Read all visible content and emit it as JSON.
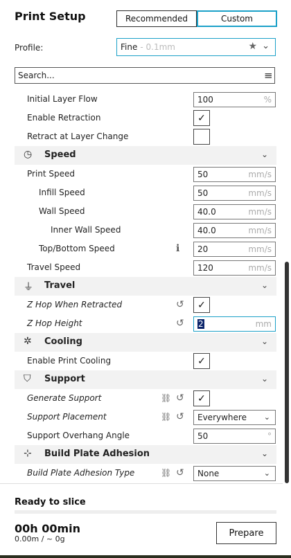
{
  "header": {
    "title": "Print Setup",
    "tabs": [
      "Recommended",
      "Custom"
    ],
    "profile_label": "Profile:",
    "profile_value": "Fine",
    "profile_sub": "- 0.1mm",
    "search_placeholder": "Search...",
    "star_icon": "★",
    "chevron": "⌄",
    "menu_icon": "≡"
  },
  "settings": {
    "initial_layer_flow": {
      "label": "Initial Layer Flow",
      "value": "100",
      "unit": "%"
    },
    "enable_retraction": {
      "label": "Enable Retraction",
      "checked": "✓"
    },
    "retract_layer_change": {
      "label": "Retract at Layer Change",
      "checked": ""
    },
    "speed_cat": {
      "label": "Speed",
      "icon": "◷"
    },
    "print_speed": {
      "label": "Print Speed",
      "value": "50",
      "unit": "mm/s"
    },
    "infill_speed": {
      "label": "Infill Speed",
      "value": "50",
      "unit": "mm/s"
    },
    "wall_speed": {
      "label": "Wall Speed",
      "value": "40.0",
      "unit": "mm/s"
    },
    "inner_wall_speed": {
      "label": "Inner Wall Speed",
      "value": "40.0",
      "unit": "mm/s"
    },
    "top_bottom_speed": {
      "label": "Top/Bottom Speed",
      "value": "20",
      "unit": "mm/s",
      "info_icon": "ℹ"
    },
    "travel_speed": {
      "label": "Travel Speed",
      "value": "120",
      "unit": "mm/s"
    },
    "travel_cat": {
      "label": "Travel",
      "icon": "⏚"
    },
    "z_hop_retracted": {
      "label": "Z Hop When Retracted",
      "checked": "✓",
      "reset_icon": "↺"
    },
    "z_hop_height": {
      "label": "Z Hop Height",
      "value": "2",
      "unit": "mm",
      "reset_icon": "↺"
    },
    "cooling_cat": {
      "label": "Cooling",
      "icon": "✲"
    },
    "enable_cooling": {
      "label": "Enable Print Cooling",
      "checked": "✓"
    },
    "support_cat": {
      "label": "Support",
      "icon": "⛉"
    },
    "generate_support": {
      "label": "Generate Support",
      "checked": "✓",
      "link_icon": "⛓",
      "reset_icon": "↺"
    },
    "support_placement": {
      "label": "Support Placement",
      "value": "Everywhere",
      "link_icon": "⛓",
      "reset_icon": "↺"
    },
    "support_overhang": {
      "label": "Support Overhang Angle",
      "value": "50",
      "unit": "°"
    },
    "adhesion_cat": {
      "label": "Build Plate Adhesion",
      "icon": "⊹"
    },
    "adhesion_type": {
      "label": "Build Plate Adhesion Type",
      "value": "None",
      "link_icon": "⛓",
      "reset_icon": "↺"
    }
  },
  "footer": {
    "status": "Ready to slice",
    "time": "00h 00min",
    "material": "0.00m / ~ 0g",
    "prepare_label": "Prepare"
  }
}
